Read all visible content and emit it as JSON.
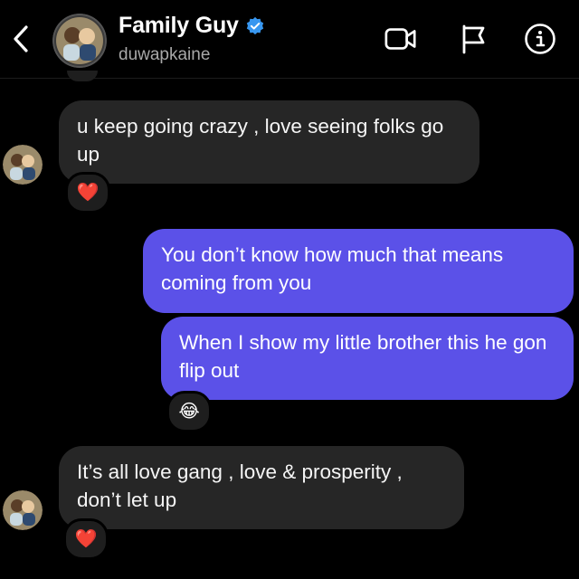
{
  "header": {
    "title": "Family Guy",
    "handle": "duwapkaine",
    "verified": true,
    "icons": [
      "back-chevron-icon",
      "video-call-icon",
      "flag-icon",
      "info-icon"
    ]
  },
  "messages": [
    {
      "side": "received",
      "text": "u keep going crazy , love seeing folks go up",
      "reaction": "❤️"
    },
    {
      "side": "sent",
      "text": "You don’t know how much that means coming from you"
    },
    {
      "side": "sent",
      "text": "When I show my little brother this he gon flip out",
      "reaction": "😂"
    },
    {
      "side": "received",
      "text": "It’s all love gang , love & prosperity , don’t let up",
      "reaction": "❤️"
    }
  ],
  "colors": {
    "background": "#000000",
    "received_bubble": "#262626",
    "sent_bubble": "#5b51e8",
    "verified_badge": "#3897f0",
    "handle_text": "#a8a8a8"
  }
}
